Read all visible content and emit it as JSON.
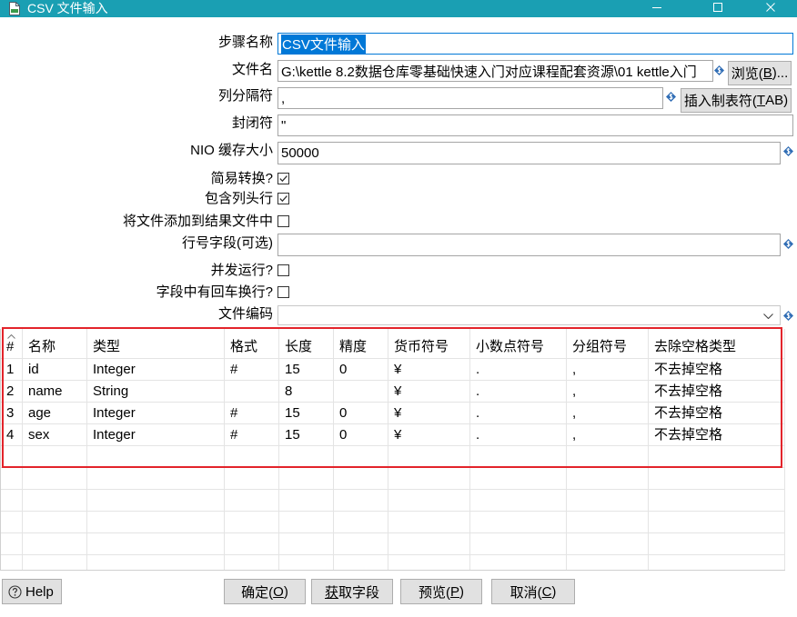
{
  "window": {
    "title": "CSV 文件输入"
  },
  "form": {
    "step_name": {
      "label": "步骤名称",
      "value": "CSV文件输入"
    },
    "file_name": {
      "label": "文件名",
      "value": "G:\\kettle 8.2数据仓库零基础快速入门对应课程配套资源\\01 kettle入门"
    },
    "browse_button": {
      "prefix": "浏览(",
      "mnemonic": "B",
      "suffix": ")..."
    },
    "delimiter": {
      "label": "列分隔符",
      "value": ","
    },
    "insert_tab_button": {
      "prefix": "插入制表符(",
      "mnemonic": "T",
      "suffix": "AB)"
    },
    "enclosure": {
      "label": "封闭符",
      "value": "\""
    },
    "nio_buffer_size": {
      "label": "NIO 缓存大小",
      "value": "50000"
    },
    "lazy_conversion": {
      "label": "简易转换?",
      "checked": true
    },
    "header_present": {
      "label": "包含列头行",
      "checked": true
    },
    "add_to_result_files": {
      "label": "将文件添加到结果文件中",
      "checked": false
    },
    "row_number_field": {
      "label": "行号字段(可选)",
      "value": ""
    },
    "run_in_parallel": {
      "label": "并发运行?",
      "checked": false
    },
    "newlines_in_fields": {
      "label": "字段中有回车换行?",
      "checked": false
    },
    "file_encoding": {
      "label": "文件编码",
      "value": ""
    }
  },
  "fields_table": {
    "columns": [
      "#",
      "名称",
      "类型",
      "格式",
      "长度",
      "精度",
      "货币符号",
      "小数点符号",
      "分组符号",
      "去除空格类型"
    ],
    "rows": [
      [
        "1",
        "id",
        "Integer",
        "#",
        "15",
        "0",
        "¥",
        ".",
        ",",
        "不去掉空格"
      ],
      [
        "2",
        "name",
        "String",
        "",
        "8",
        "",
        "¥",
        ".",
        ",",
        "不去掉空格"
      ],
      [
        "3",
        "age",
        "Integer",
        "#",
        "15",
        "0",
        "¥",
        ".",
        ",",
        "不去掉空格"
      ],
      [
        "4",
        "sex",
        "Integer",
        "#",
        "15",
        "0",
        "¥",
        ".",
        ",",
        "不去掉空格"
      ]
    ]
  },
  "buttons": {
    "help": "Help",
    "ok": {
      "prefix": "确定(",
      "mnemonic": "O",
      "suffix": ")"
    },
    "get_fields": {
      "prefix": "",
      "mnemonic": "获",
      "suffix": "取字段"
    },
    "preview": {
      "prefix": "预览(",
      "mnemonic": "P",
      "suffix": ")"
    },
    "cancel": {
      "prefix": "取消(",
      "mnemonic": "C",
      "suffix": ")"
    }
  },
  "colors": {
    "title_bar": "#1a9fb3",
    "selection": "#0078d7",
    "variable_icon": "#2f6db5",
    "annotation_box": "#e3242b",
    "button_face": "#e1e1e1"
  },
  "icons": {
    "title": "csv-input-step-icon",
    "window_controls": [
      "minimize-icon",
      "maximize-icon",
      "close-icon"
    ],
    "variable": "variable-icon",
    "checkbox_checked": "check-icon",
    "dropdown": "chevron-down-icon",
    "table_sort": "sort-ascending-icon",
    "help": "help-circle-icon"
  }
}
